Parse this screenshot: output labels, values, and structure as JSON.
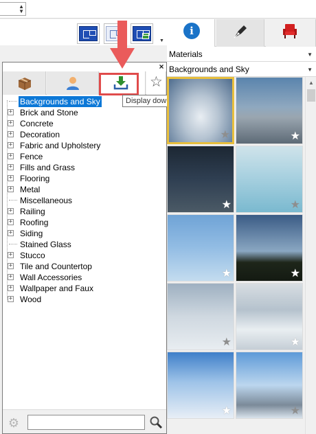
{
  "top": {
    "combo_value": "",
    "spin_up": "▲",
    "spin_down": "▼"
  },
  "toolbar": {
    "more_arrow": "▼",
    "icons": [
      "floor-plan-icon",
      "floor-plan-grid-icon",
      "elevation-icon"
    ]
  },
  "right_tabs": [
    {
      "name": "info",
      "icon": "info-icon",
      "glyph": "i"
    },
    {
      "name": "pen",
      "icon": "fountain-pen-icon"
    },
    {
      "name": "furniture",
      "icon": "armchair-icon"
    }
  ],
  "selectors": {
    "materials": {
      "value": "Materials",
      "arrow": "▼"
    },
    "subcategory": {
      "value": "Backgrounds and Sky",
      "arrow": "▼"
    }
  },
  "panel": {
    "close_label": "×",
    "tabs": [
      {
        "icon": "package-box-icon"
      },
      {
        "icon": "user-icon"
      },
      {
        "icon": "download-icon",
        "selected": true
      },
      {
        "icon": "star-icon",
        "glyph": "☆"
      }
    ],
    "tooltip": "Display downloaded library items"
  },
  "tree": {
    "items": [
      {
        "label": "Backgrounds and Sky",
        "expandable": false,
        "selected": true
      },
      {
        "label": "Brick and Stone",
        "expandable": true
      },
      {
        "label": "Concrete",
        "expandable": true
      },
      {
        "label": "Decoration",
        "expandable": true
      },
      {
        "label": "Fabric and Upholstery",
        "expandable": true
      },
      {
        "label": "Fence",
        "expandable": true
      },
      {
        "label": "Fills and Grass",
        "expandable": true
      },
      {
        "label": "Flooring",
        "expandable": true
      },
      {
        "label": "Metal",
        "expandable": true
      },
      {
        "label": "Miscellaneous",
        "expandable": false
      },
      {
        "label": "Railing",
        "expandable": true
      },
      {
        "label": "Roofing",
        "expandable": true
      },
      {
        "label": "Siding",
        "expandable": true
      },
      {
        "label": "Stained Glass",
        "expandable": false
      },
      {
        "label": "Stucco",
        "expandable": true
      },
      {
        "label": "Tile and Countertop",
        "expandable": true
      },
      {
        "label": "Wall Accessories",
        "expandable": true
      },
      {
        "label": "Wallpaper and Faux",
        "expandable": true
      },
      {
        "label": "Wood",
        "expandable": true
      }
    ],
    "expand_glyph": "+"
  },
  "search": {
    "value": "",
    "placeholder": "",
    "gear_icon": "gear-icon",
    "search_icon": "magnifier-icon"
  },
  "thumbnails": {
    "star_glyph": "★",
    "items": [
      {
        "name": "sky-clouds-1",
        "selected": true
      },
      {
        "name": "sky-clouds-2"
      },
      {
        "name": "sky-dusk-1"
      },
      {
        "name": "sky-haze-1"
      },
      {
        "name": "sky-blue-1"
      },
      {
        "name": "sky-treeline-1"
      },
      {
        "name": "sky-overcast-1"
      },
      {
        "name": "sky-overcast-2"
      },
      {
        "name": "sky-blue-2"
      },
      {
        "name": "sky-mountains-1"
      }
    ]
  },
  "colors": {
    "selection": "#0c78d7",
    "highlight_box": "#e04b4b",
    "selected_thumb_border": "#e8bf3d",
    "info_blue": "#1a73c8"
  }
}
